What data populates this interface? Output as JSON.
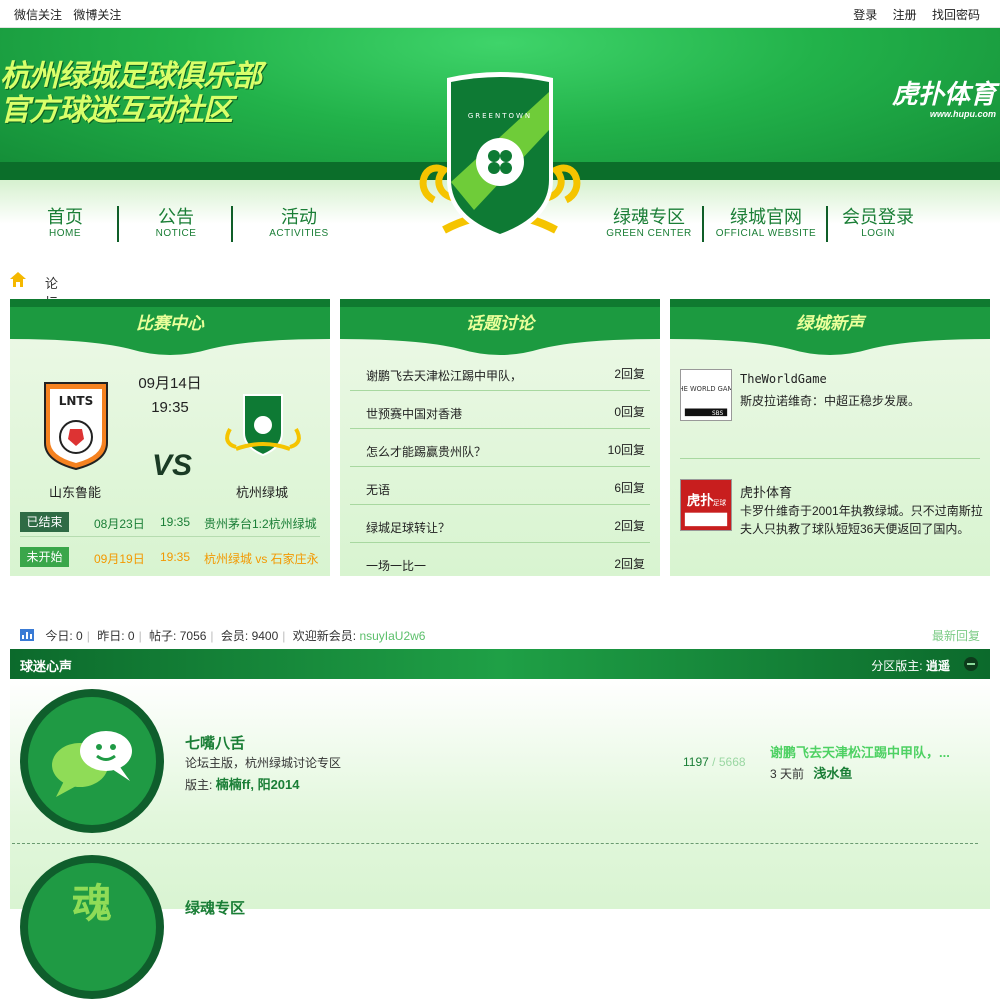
{
  "topbar": {
    "left": [
      "微信关注",
      "微博关注"
    ],
    "right": [
      "登录",
      "注册",
      "找回密码"
    ]
  },
  "banner": {
    "slogan_line1": "杭州绿城足球俱乐部",
    "slogan_line2": "官方球迷互动社区",
    "brand": "虎扑体育",
    "brand_url": "www.hupu.com",
    "crest_text": "GREENTOWN"
  },
  "nav": [
    {
      "cn": "首页",
      "en": "HOME"
    },
    {
      "cn": "公告",
      "en": "NOTICE"
    },
    {
      "cn": "活动",
      "en": "ACTIVITIES"
    },
    {
      "cn": "绿魂专区",
      "en": "GREEN CENTER"
    },
    {
      "cn": "绿城官网",
      "en": "OFFICIAL WEBSITE"
    },
    {
      "cn": "会员登录",
      "en": "LOGIN"
    }
  ],
  "breadcrumb": {
    "label": "论坛"
  },
  "match_center": {
    "title": "比赛中心",
    "date": "09月14日",
    "time": "19:35",
    "home_team": "山东鲁能",
    "away_team": "杭州绿城",
    "home_logo_text": "LNTS",
    "vs": "VS",
    "rows": [
      {
        "status": "已结束",
        "date": "08月23日",
        "time": "19:35",
        "result": "贵州茅台1:2杭州绿城",
        "color": "#2f6b45"
      },
      {
        "status": "未开始",
        "date": "09月19日",
        "time": "19:35",
        "result": "杭州绿城 vs 石家庄永",
        "color": "#3aa64a"
      }
    ]
  },
  "topics": {
    "title": "话题讨论",
    "items": [
      {
        "title": "谢鹏飞去天津松江踢中甲队，",
        "replies": "2回复"
      },
      {
        "title": "世预赛中国对香港",
        "replies": "0回复"
      },
      {
        "title": "怎么才能踢赢贵州队？",
        "replies": "10回复"
      },
      {
        "title": "无语",
        "replies": "6回复"
      },
      {
        "title": "绿城足球转让？",
        "replies": "2回复"
      },
      {
        "title": "一场一比一",
        "replies": "2回复"
      }
    ]
  },
  "news": {
    "title": "绿城新声",
    "items": [
      {
        "source": "TheWorldGame",
        "text": "斯皮拉诺维奇：中超正稳步发展。",
        "logo": "THE WORLD GAME",
        "logo_sub": "SBS"
      },
      {
        "source": "虎扑体育",
        "text": "卡罗什维奇于2001年执教绿城。只不过南斯拉夫人只执教了球队短短36天便返回了国内。",
        "logo": "虎扑",
        "logo_sub": "足球"
      }
    ]
  },
  "stats": {
    "today_label": "今日:",
    "today": "0",
    "yesterday_label": "昨日:",
    "yesterday": "0",
    "posts_label": "帖子:",
    "posts": "7056",
    "members_label": "会员:",
    "members": "9400",
    "welcome_label": "欢迎新会员:",
    "new_member": "nsuyIaU2w6",
    "latest_label": "最新回复"
  },
  "section": {
    "title": "球迷心声",
    "moderator_label": "分区版主:",
    "moderator": "逍遥"
  },
  "forums": [
    {
      "name": "七嘴八舌",
      "desc": "论坛主版，杭州绿城讨论专区",
      "mod_label": "版主:",
      "mods": "楠楠ff, 阳2014",
      "threads": "1197",
      "posts": "5668",
      "last_title": "谢鹏飞去天津松江踢中甲队，...",
      "last_time": "3 天前",
      "last_user": "浅水鱼"
    },
    {
      "name": "绿魂专区",
      "icon_char": "魂"
    }
  ],
  "colors": {
    "brand_green": "#1a7e36",
    "accent_lime": "#d9ff6a",
    "dark_green": "#0c6a2c"
  }
}
